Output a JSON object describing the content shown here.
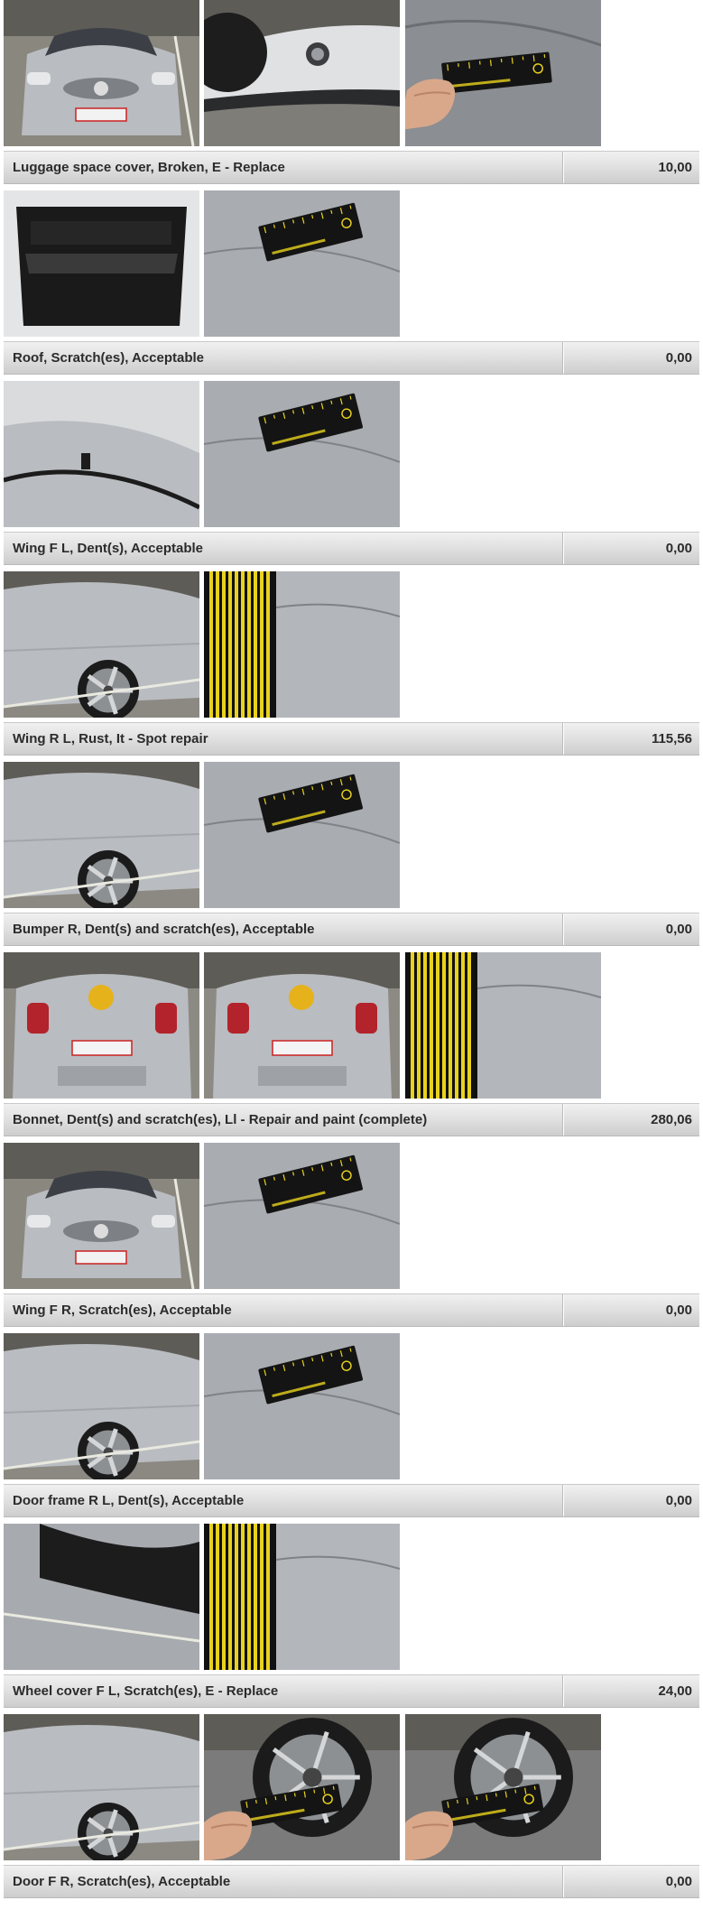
{
  "colors": {
    "bar_top": "#f1f1f1",
    "bar_bottom": "#cdcdcd",
    "text": "#2b2b2b",
    "car_silver": "#b9bcc0",
    "floor": "#8f8c84",
    "gauge_black": "#141414",
    "gauge_yellow": "#e8d21c"
  },
  "groups": [
    {
      "photos": [
        {
          "alt": "Front view of silver Opel Corsa in parking garage",
          "kind": "car-front",
          "icon": "car-photo-icon"
        },
        {
          "alt": "Close-up of front bumper and fog light",
          "kind": "bumper",
          "icon": "car-photo-icon"
        },
        {
          "alt": "Hand holding measuring gauge against scratch",
          "kind": "gauge-hand",
          "icon": "car-photo-icon"
        }
      ],
      "description": "Luggage space cover, Broken, E - Replace",
      "amount": "10,00"
    },
    {
      "photos": [
        {
          "alt": "Open boot showing luggage space",
          "kind": "boot",
          "icon": "car-photo-icon"
        },
        {
          "alt": "Gauge on luggage cover",
          "kind": "gauge-panel",
          "icon": "car-photo-icon"
        }
      ],
      "description": "Roof, Scratch(es), Acceptable",
      "amount": "0,00"
    },
    {
      "photos": [
        {
          "alt": "Roof panel close-up",
          "kind": "roof",
          "icon": "car-photo-icon"
        },
        {
          "alt": "Gauge on roof scratch",
          "kind": "gauge-panel",
          "icon": "car-photo-icon"
        }
      ],
      "description": "Wing F L, Dent(s), Acceptable",
      "amount": "0,00"
    },
    {
      "photos": [
        {
          "alt": "Front left wing and wheel",
          "kind": "side",
          "icon": "car-photo-icon"
        },
        {
          "alt": "Striped gauge on front left wing",
          "kind": "stripes",
          "icon": "car-photo-icon"
        }
      ],
      "description": "Wing R L, Rust, It - Spot repair",
      "amount": "115,56"
    },
    {
      "photos": [
        {
          "alt": "Rear left wing and wheel",
          "kind": "side",
          "icon": "car-photo-icon"
        },
        {
          "alt": "Gauge on rear left wing",
          "kind": "gauge-panel",
          "icon": "car-photo-icon"
        }
      ],
      "description": "Bumper R, Dent(s) and scratch(es), Acceptable",
      "amount": "0,00"
    },
    {
      "photos": [
        {
          "alt": "Rear view of car with plate",
          "kind": "car-rear",
          "icon": "car-photo-icon"
        },
        {
          "alt": "Rear bumper close-up with plate",
          "kind": "car-rear",
          "icon": "car-photo-icon"
        },
        {
          "alt": "Striped gauge on rear bumper",
          "kind": "stripes",
          "icon": "car-photo-icon"
        }
      ],
      "description": "Bonnet, Dent(s) and scratch(es), Ll - Repair and paint (complete)",
      "amount": "280,06"
    },
    {
      "photos": [
        {
          "alt": "Bonnet front view",
          "kind": "car-front",
          "icon": "car-photo-icon"
        },
        {
          "alt": "Gauge on bonnet",
          "kind": "gauge-panel",
          "icon": "car-photo-icon"
        }
      ],
      "description": "Wing F R, Scratch(es), Acceptable",
      "amount": "0,00"
    },
    {
      "photos": [
        {
          "alt": "Front right wing and wheel",
          "kind": "side",
          "icon": "car-photo-icon"
        },
        {
          "alt": "Gauge on front right wing",
          "kind": "gauge-panel",
          "icon": "car-photo-icon"
        }
      ],
      "description": "Door frame R L, Dent(s), Acceptable",
      "amount": "0,00"
    },
    {
      "photos": [
        {
          "alt": "Open rear left door frame",
          "kind": "door",
          "icon": "car-photo-icon"
        },
        {
          "alt": "Striped gauge on door frame",
          "kind": "stripes",
          "icon": "car-photo-icon"
        }
      ],
      "description": "Wheel cover F L, Scratch(es), E - Replace",
      "amount": "24,00"
    },
    {
      "photos": [
        {
          "alt": "Front left wheel",
          "kind": "side",
          "icon": "car-photo-icon"
        },
        {
          "alt": "Hand with gauge on wheel",
          "kind": "wheel-hand",
          "icon": "car-photo-icon"
        },
        {
          "alt": "Hand with gauge on wheel cover",
          "kind": "wheel-hand",
          "icon": "car-photo-icon"
        }
      ],
      "description": "Door F R, Scratch(es), Acceptable",
      "amount": "0,00"
    }
  ]
}
